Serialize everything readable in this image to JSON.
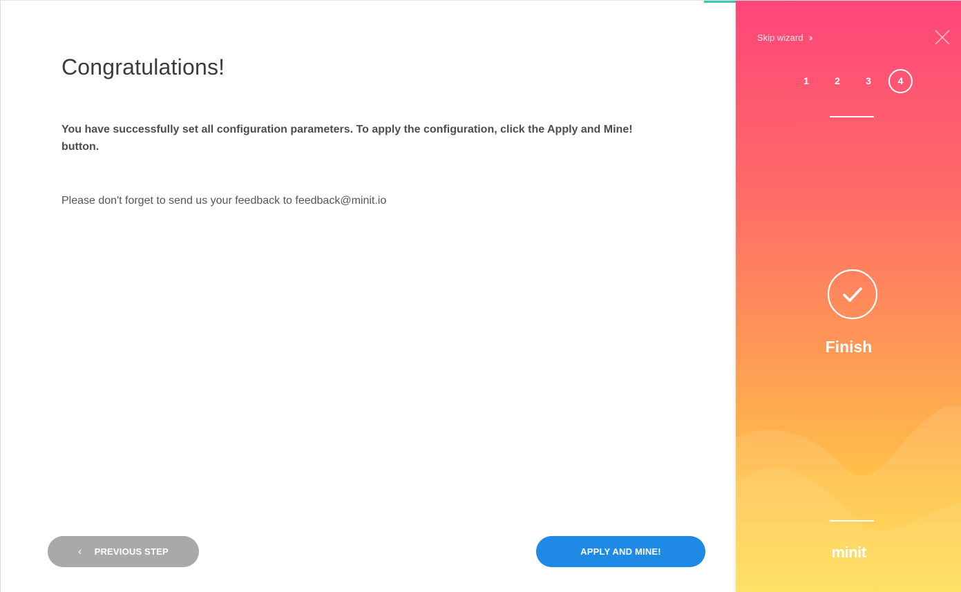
{
  "main": {
    "title": "Congratulations!",
    "lead": "You have successfully set all configuration parameters. To apply the configuration, click the Apply and Mine! button.",
    "note": "Please don't forget to send us your feedback to feedback@minit.io",
    "prev_button": {
      "icon": "chevron-left-icon",
      "label": "PREVIOUS STEP"
    },
    "apply_button": {
      "label": "APPLY AND MINE!"
    }
  },
  "sidebar": {
    "skip_label": "Skip wizard",
    "skip_icon": "double-chevron-right-icon",
    "close_icon": "close-icon",
    "steps": [
      "1",
      "2",
      "3",
      "4"
    ],
    "active_step": "4",
    "finish_icon": "check-circle-icon",
    "finish_label": "Finish",
    "logo": "minit"
  },
  "colors": {
    "primary": "#1e8ae6",
    "secondary_button": "#a9a9a9",
    "sidebar_top": "#ff4679",
    "sidebar_bottom": "#ffdc48",
    "text_dark": "#3b3b3b"
  }
}
